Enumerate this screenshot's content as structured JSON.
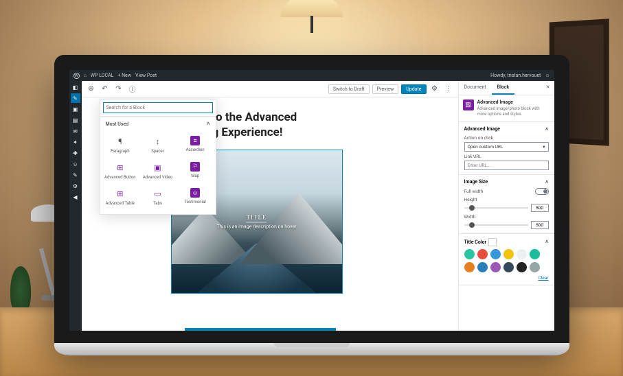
{
  "adminbar": {
    "site": "WP LOCAL",
    "new": "+ New",
    "view": "View Post",
    "greeting": "Howdy, tristan.hervouet"
  },
  "topbar": {
    "switch_draft": "Switch to Draft",
    "preview": "Preview",
    "update": "Update"
  },
  "inserter": {
    "search_placeholder": "Search for a Block",
    "section": "Most Used",
    "blocks": [
      {
        "label": "Paragraph",
        "glyph": "¶",
        "cls": ""
      },
      {
        "label": "Spacer",
        "glyph": "↕",
        "cls": ""
      },
      {
        "label": "Accordion",
        "glyph": "≡",
        "cls": "purple fill"
      },
      {
        "label": "Advanced Button",
        "glyph": "⊞",
        "cls": "purple"
      },
      {
        "label": "Advanced Video",
        "glyph": "▣",
        "cls": "purple"
      },
      {
        "label": "Map",
        "glyph": "⚐",
        "cls": "purple fill"
      },
      {
        "label": "Advanced Table",
        "glyph": "⊞",
        "cls": "purple"
      },
      {
        "label": "Tabs",
        "glyph": "▭",
        "cls": "purple"
      },
      {
        "label": "Testimonial",
        "glyph": "☺",
        "cls": "purple fill"
      }
    ]
  },
  "canvas": {
    "heading_line1": "to the Advanced",
    "heading_line2": "g Experience!",
    "image_title": "TITLE",
    "image_desc": "This is an image description on hover"
  },
  "sidebar": {
    "tabs": {
      "document": "Document",
      "block": "Block"
    },
    "block_name": "Advanced Image",
    "block_desc": "Advanced image/photo block with more options and styles.",
    "adv_image": {
      "title": "Advanced Image",
      "action_label": "Action on click",
      "action_value": "Open custom URL",
      "link_label": "Link URL",
      "link_placeholder": "Enter URL..."
    },
    "image_size": {
      "title": "Image Size",
      "full_width": "Full width",
      "height": "Height",
      "height_val": "500",
      "width": "Width",
      "width_val": "500"
    },
    "title_color": {
      "title": "Title Color",
      "clear": "Clear",
      "colors": [
        "#2bc4a0",
        "#e84c3d",
        "#3498db",
        "#f1c40f",
        "#ecf0f1",
        "#1abc9c",
        "#e67e22",
        "#2980b9",
        "#9b59b6",
        "#34495e",
        "#222222",
        "#95a5a6"
      ]
    }
  }
}
